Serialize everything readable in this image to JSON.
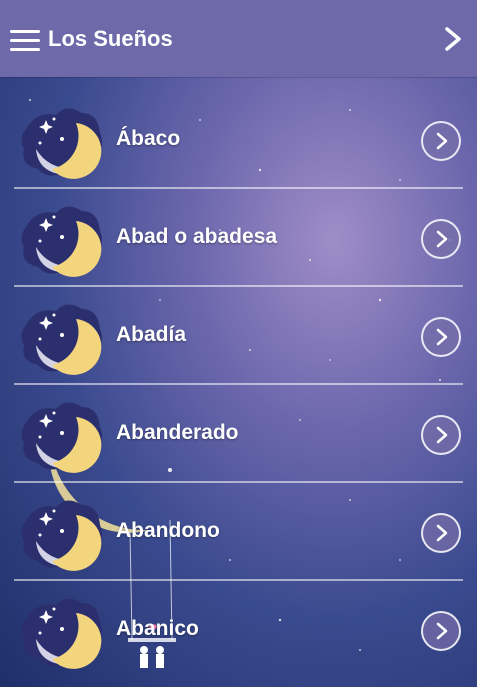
{
  "header": {
    "title": "Los Sueños",
    "menu_icon": "hamburger-menu-icon",
    "next_icon": "chevron-right-icon"
  },
  "colors": {
    "header_bg": "#6e69a9",
    "text": "#ffffff"
  },
  "items": [
    {
      "label": "Ábaco"
    },
    {
      "label": "Abad o abadesa"
    },
    {
      "label": "Abadía"
    },
    {
      "label": "Abanderado"
    },
    {
      "label": "Abandono"
    },
    {
      "label": "Abanico"
    }
  ]
}
